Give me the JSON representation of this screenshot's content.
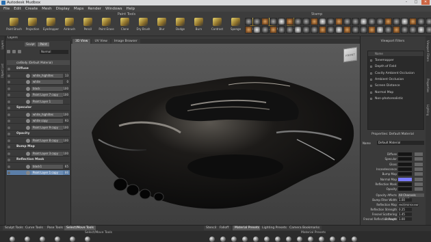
{
  "window": {
    "title": "Autodesk Mudbox",
    "buttons": [
      "–",
      "□",
      "✕"
    ]
  },
  "menu": [
    "File",
    "Edit",
    "Create",
    "Mesh",
    "Display",
    "Maps",
    "Render",
    "Windows",
    "Help"
  ],
  "paint_tools": {
    "title": "Paint Tools",
    "tools": [
      "Paint Brush",
      "Projection",
      "Eyedropper",
      "Airbrush",
      "Pencil",
      "Paint Erase",
      "Clone",
      "Dry Brush",
      "Blur",
      "Dodge",
      "Burn",
      "Contrast",
      "Sponge",
      "Hue",
      "Hue Shift",
      "Invert"
    ]
  },
  "stamp": {
    "title": "Stamp",
    "count": 46
  },
  "left_strip": [
    "Layers",
    "Object List"
  ],
  "layers": {
    "title": "Layers",
    "mode_tabs": [
      "Sculpt",
      "Paint"
    ],
    "active_mode": "Paint",
    "blend_mode": "Normal",
    "mesh": "carBody (Default Material)",
    "rows": [
      {
        "type": "group",
        "label": "Diffuse"
      },
      {
        "type": "layer",
        "label": "white_highlites",
        "pct": "13"
      },
      {
        "type": "layer",
        "label": "white",
        "pct": "0"
      },
      {
        "type": "layer",
        "label": "black",
        "pct": "100"
      },
      {
        "type": "layer",
        "label": "Paint Layer 7 copy",
        "pct": "100"
      },
      {
        "type": "layer",
        "label": "Paint Layer 1",
        "pct": ""
      },
      {
        "type": "group",
        "label": "Specular"
      },
      {
        "type": "layer",
        "label": "white_highlites",
        "pct": "100"
      },
      {
        "type": "layer",
        "label": "white copy",
        "pct": "93"
      },
      {
        "type": "layer",
        "label": "Paint Layer 9 copy",
        "pct": "100"
      },
      {
        "type": "group",
        "label": "Opacity"
      },
      {
        "type": "layer",
        "label": "Paint Layer 8 copy",
        "pct": "100"
      },
      {
        "type": "group",
        "label": "Bump Map"
      },
      {
        "type": "layer",
        "label": "Paint Layer 3 copy",
        "pct": "100"
      },
      {
        "type": "group",
        "label": "Reflection Mask"
      },
      {
        "type": "layer",
        "label": "black1",
        "pct": "65"
      },
      {
        "type": "layer",
        "label": "Paint Layer 1 copy",
        "pct": "86",
        "selected": true
      }
    ]
  },
  "viewport": {
    "tabs": [
      "3D View",
      "UV View",
      "Image Browser"
    ],
    "active": "3D View",
    "cube_label": "FRONT"
  },
  "right_strip": [
    "Viewport Filters",
    "Properties",
    "Lighting"
  ],
  "viewport_filters": {
    "title": "Viewport Filters",
    "header": "Name",
    "items": [
      "Tonemapper",
      "Depth of Field",
      "Cavity Ambient Occlusion",
      "Ambient Occlusion",
      "Screen Distance",
      "Normal Map",
      "Non-photorealistic"
    ]
  },
  "properties": {
    "title": "Properties: Default Material",
    "name_label": "Name",
    "name_value": "Default Material",
    "colors": [
      {
        "label": "Diffuse",
        "color": "#151515"
      },
      {
        "label": "Specular",
        "color": "#151515"
      },
      {
        "label": "Gloss",
        "color": "#151515"
      },
      {
        "label": "Incandescence",
        "color": "#151515"
      },
      {
        "label": "Bump Map",
        "color": "#151515"
      },
      {
        "label": "Normal Map",
        "color": "#7a7aff"
      },
      {
        "label": "Reflection Mask",
        "color": "#151515"
      },
      {
        "label": "Opacity",
        "color": "#151515"
      }
    ],
    "fields": [
      {
        "label": "Opacity Affects",
        "value": "All Channels (colour)",
        "kind": "dropdown"
      },
      {
        "label": "Bump Filter Width",
        "value": "1.00",
        "kind": "value"
      },
      {
        "label": "Reflection Map",
        "value": "rect/mirror.exr",
        "kind": "value"
      },
      {
        "label": "Reflection Strength",
        "value": "0.25",
        "kind": "value"
      },
      {
        "label": "Fresnel Scattering Strength",
        "value": "1.45",
        "kind": "value"
      },
      {
        "label": "Fresnel Reflection Power",
        "value": "1.00",
        "kind": "value"
      }
    ]
  },
  "bottom_tabs_left": [
    "Sculpt Tools",
    "Curve Tools",
    "Pose Tools",
    "Select/Move Tools"
  ],
  "bottom_tabs_left_active": "Select/Move Tools",
  "bottom_tabs_right": [
    "Stencil",
    "Falloff",
    "Material Presets",
    "Lighting Presets",
    "Camera Bookmarks"
  ],
  "bottom_tabs_right_active": "Material Presets",
  "tray": {
    "left_title": "Select/Move Tools",
    "right_title": "Material Presets"
  }
}
